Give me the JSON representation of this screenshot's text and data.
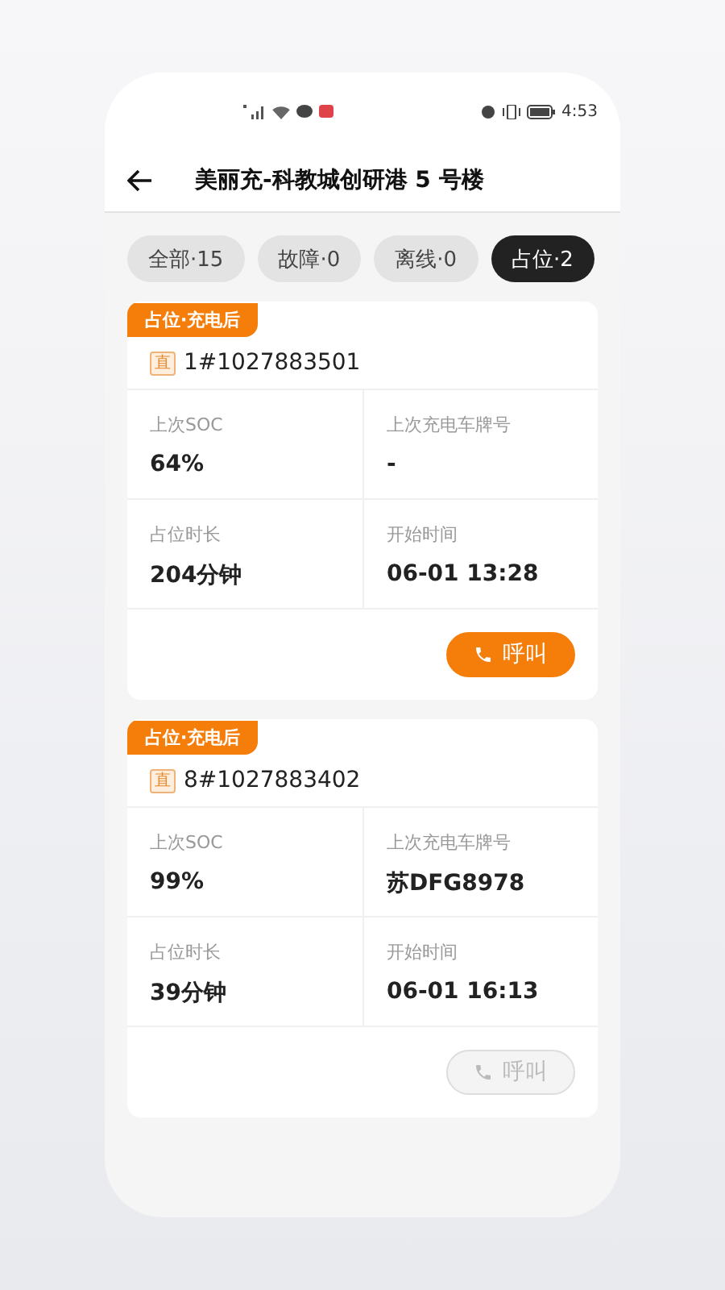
{
  "status_bar": {
    "time": "4:53"
  },
  "header": {
    "title": "美丽充-科教城创研港 5 号楼"
  },
  "tabs": [
    {
      "label": "全部·15",
      "selected": false
    },
    {
      "label": "故障·0",
      "selected": false
    },
    {
      "label": "离线·0",
      "selected": false
    },
    {
      "label": "占位·2",
      "selected": true
    }
  ],
  "cards": [
    {
      "tag": "占位·充电后",
      "type_badge": "直",
      "charger_id": "1#1027883501",
      "fields": [
        {
          "label": "上次SOC",
          "value": "64%"
        },
        {
          "label": "上次充电车牌号",
          "value": "-"
        },
        {
          "label": "占位时长",
          "value": "204分钟"
        },
        {
          "label": "开始时间",
          "value": "06-01 13:28"
        }
      ],
      "call_button": {
        "label": "呼叫",
        "disabled": false
      }
    },
    {
      "tag": "占位·充电后",
      "type_badge": "直",
      "charger_id": "8#1027883402",
      "fields": [
        {
          "label": "上次SOC",
          "value": "99%"
        },
        {
          "label": "上次充电车牌号",
          "value": "苏DFG8978"
        },
        {
          "label": "占位时长",
          "value": "39分钟"
        },
        {
          "label": "开始时间",
          "value": "06-01 16:13"
        }
      ],
      "call_button": {
        "label": "呼叫",
        "disabled": true
      }
    }
  ]
}
